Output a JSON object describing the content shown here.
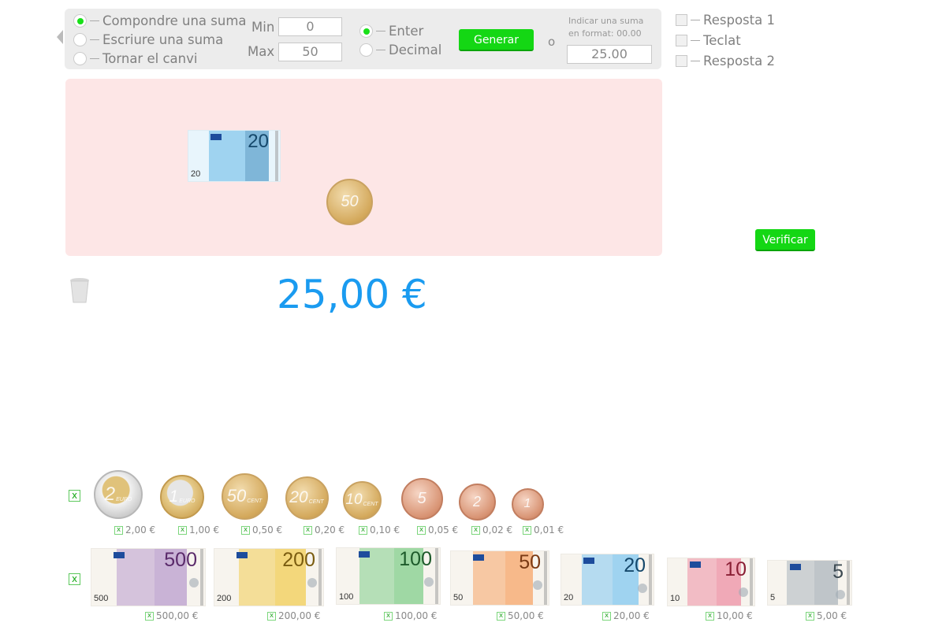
{
  "mode_options": [
    "Compondre una suma",
    "Escriure una suma",
    "Tornar el canvi"
  ],
  "mode_selected": 0,
  "min_label": "Min",
  "min_value": "0",
  "max_label": "Max",
  "max_value": "50",
  "number_type_options": [
    "Enter",
    "Decimal"
  ],
  "number_type_selected": 0,
  "generate_label": "Generar",
  "or_label": "o",
  "format_hint_line1": "Indicar una suma",
  "format_hint_line2": "en format: 00.00",
  "sum_input_value": "25.00",
  "checkboxes": [
    "Resposta 1",
    "Teclat",
    "Resposta 2"
  ],
  "verify_label": "Verificar",
  "total_display": "25,00 €",
  "play_area_items": [
    {
      "kind": "bill",
      "value": "20"
    },
    {
      "kind": "coin",
      "value": "50"
    }
  ],
  "coins": [
    {
      "face": "2",
      "sub": "EURO",
      "label": "2,00 €"
    },
    {
      "face": "1",
      "sub": "EURO",
      "label": "1,00 €"
    },
    {
      "face": "50",
      "sub": "CENT",
      "label": "0,50 €"
    },
    {
      "face": "20",
      "sub": "CENT",
      "label": "0,20 €"
    },
    {
      "face": "10",
      "sub": "CENT",
      "label": "0,10 €"
    },
    {
      "face": "5",
      "sub": "",
      "label": "0,05 €"
    },
    {
      "face": "2",
      "sub": "",
      "label": "0,02 €"
    },
    {
      "face": "1",
      "sub": "",
      "label": "0,01 €"
    }
  ],
  "bills": [
    {
      "face": "500",
      "small": "500",
      "label": "500,00 €",
      "color": "#c9b3d6"
    },
    {
      "face": "200",
      "small": "200",
      "label": "200,00 €",
      "color": "#f3d77b"
    },
    {
      "face": "100",
      "small": "100",
      "label": "100,00 €",
      "color": "#9fd8a4"
    },
    {
      "face": "50",
      "small": "50",
      "label": "50,00 €",
      "color": "#f7b98a"
    },
    {
      "face": "20",
      "small": "20",
      "label": "20,00 €",
      "color": "#9fd3f0"
    },
    {
      "face": "10",
      "small": "10",
      "label": "10,00 €",
      "color": "#f0a9b7"
    },
    {
      "face": "5",
      "small": "5",
      "label": "5,00 €",
      "color": "#bfc5c9"
    }
  ],
  "toggle_symbol": "x",
  "euro_word": "EURO",
  "cent_word": "CENT"
}
